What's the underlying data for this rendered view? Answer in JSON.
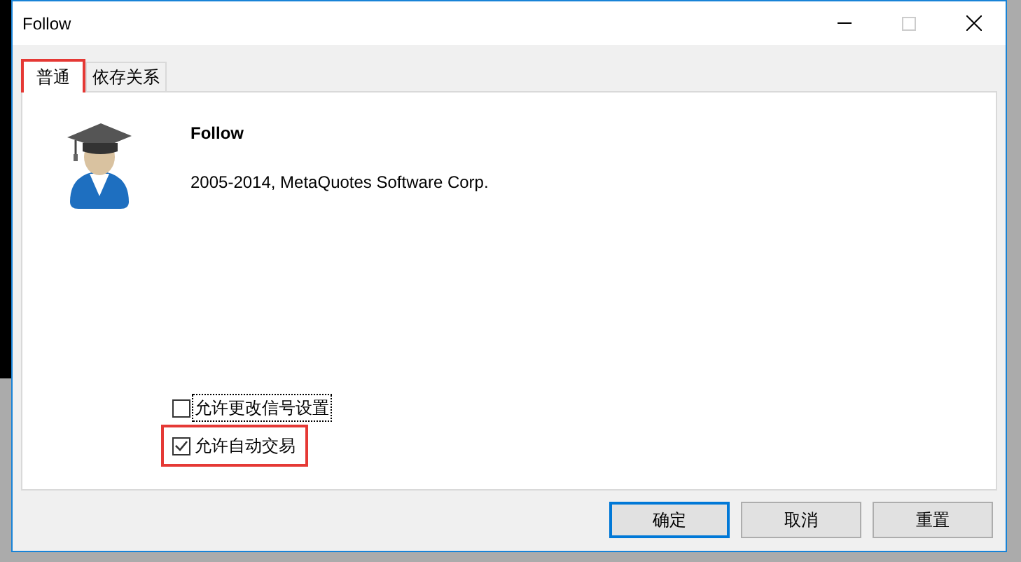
{
  "window": {
    "title": "Follow"
  },
  "tabs": [
    {
      "label": "普通",
      "selected": true
    },
    {
      "label": "依存关系",
      "selected": false
    }
  ],
  "program": {
    "name": "Follow",
    "copyright": "2005-2014, MetaQuotes Software Corp."
  },
  "options": [
    {
      "label": "允许更改信号设置",
      "checked": false,
      "focused": true
    },
    {
      "label": "允许自动交易",
      "checked": true,
      "focused": false
    }
  ],
  "buttons": [
    {
      "label": "确定",
      "default": true
    },
    {
      "label": "取消",
      "default": false
    },
    {
      "label": "重置",
      "default": false
    }
  ]
}
